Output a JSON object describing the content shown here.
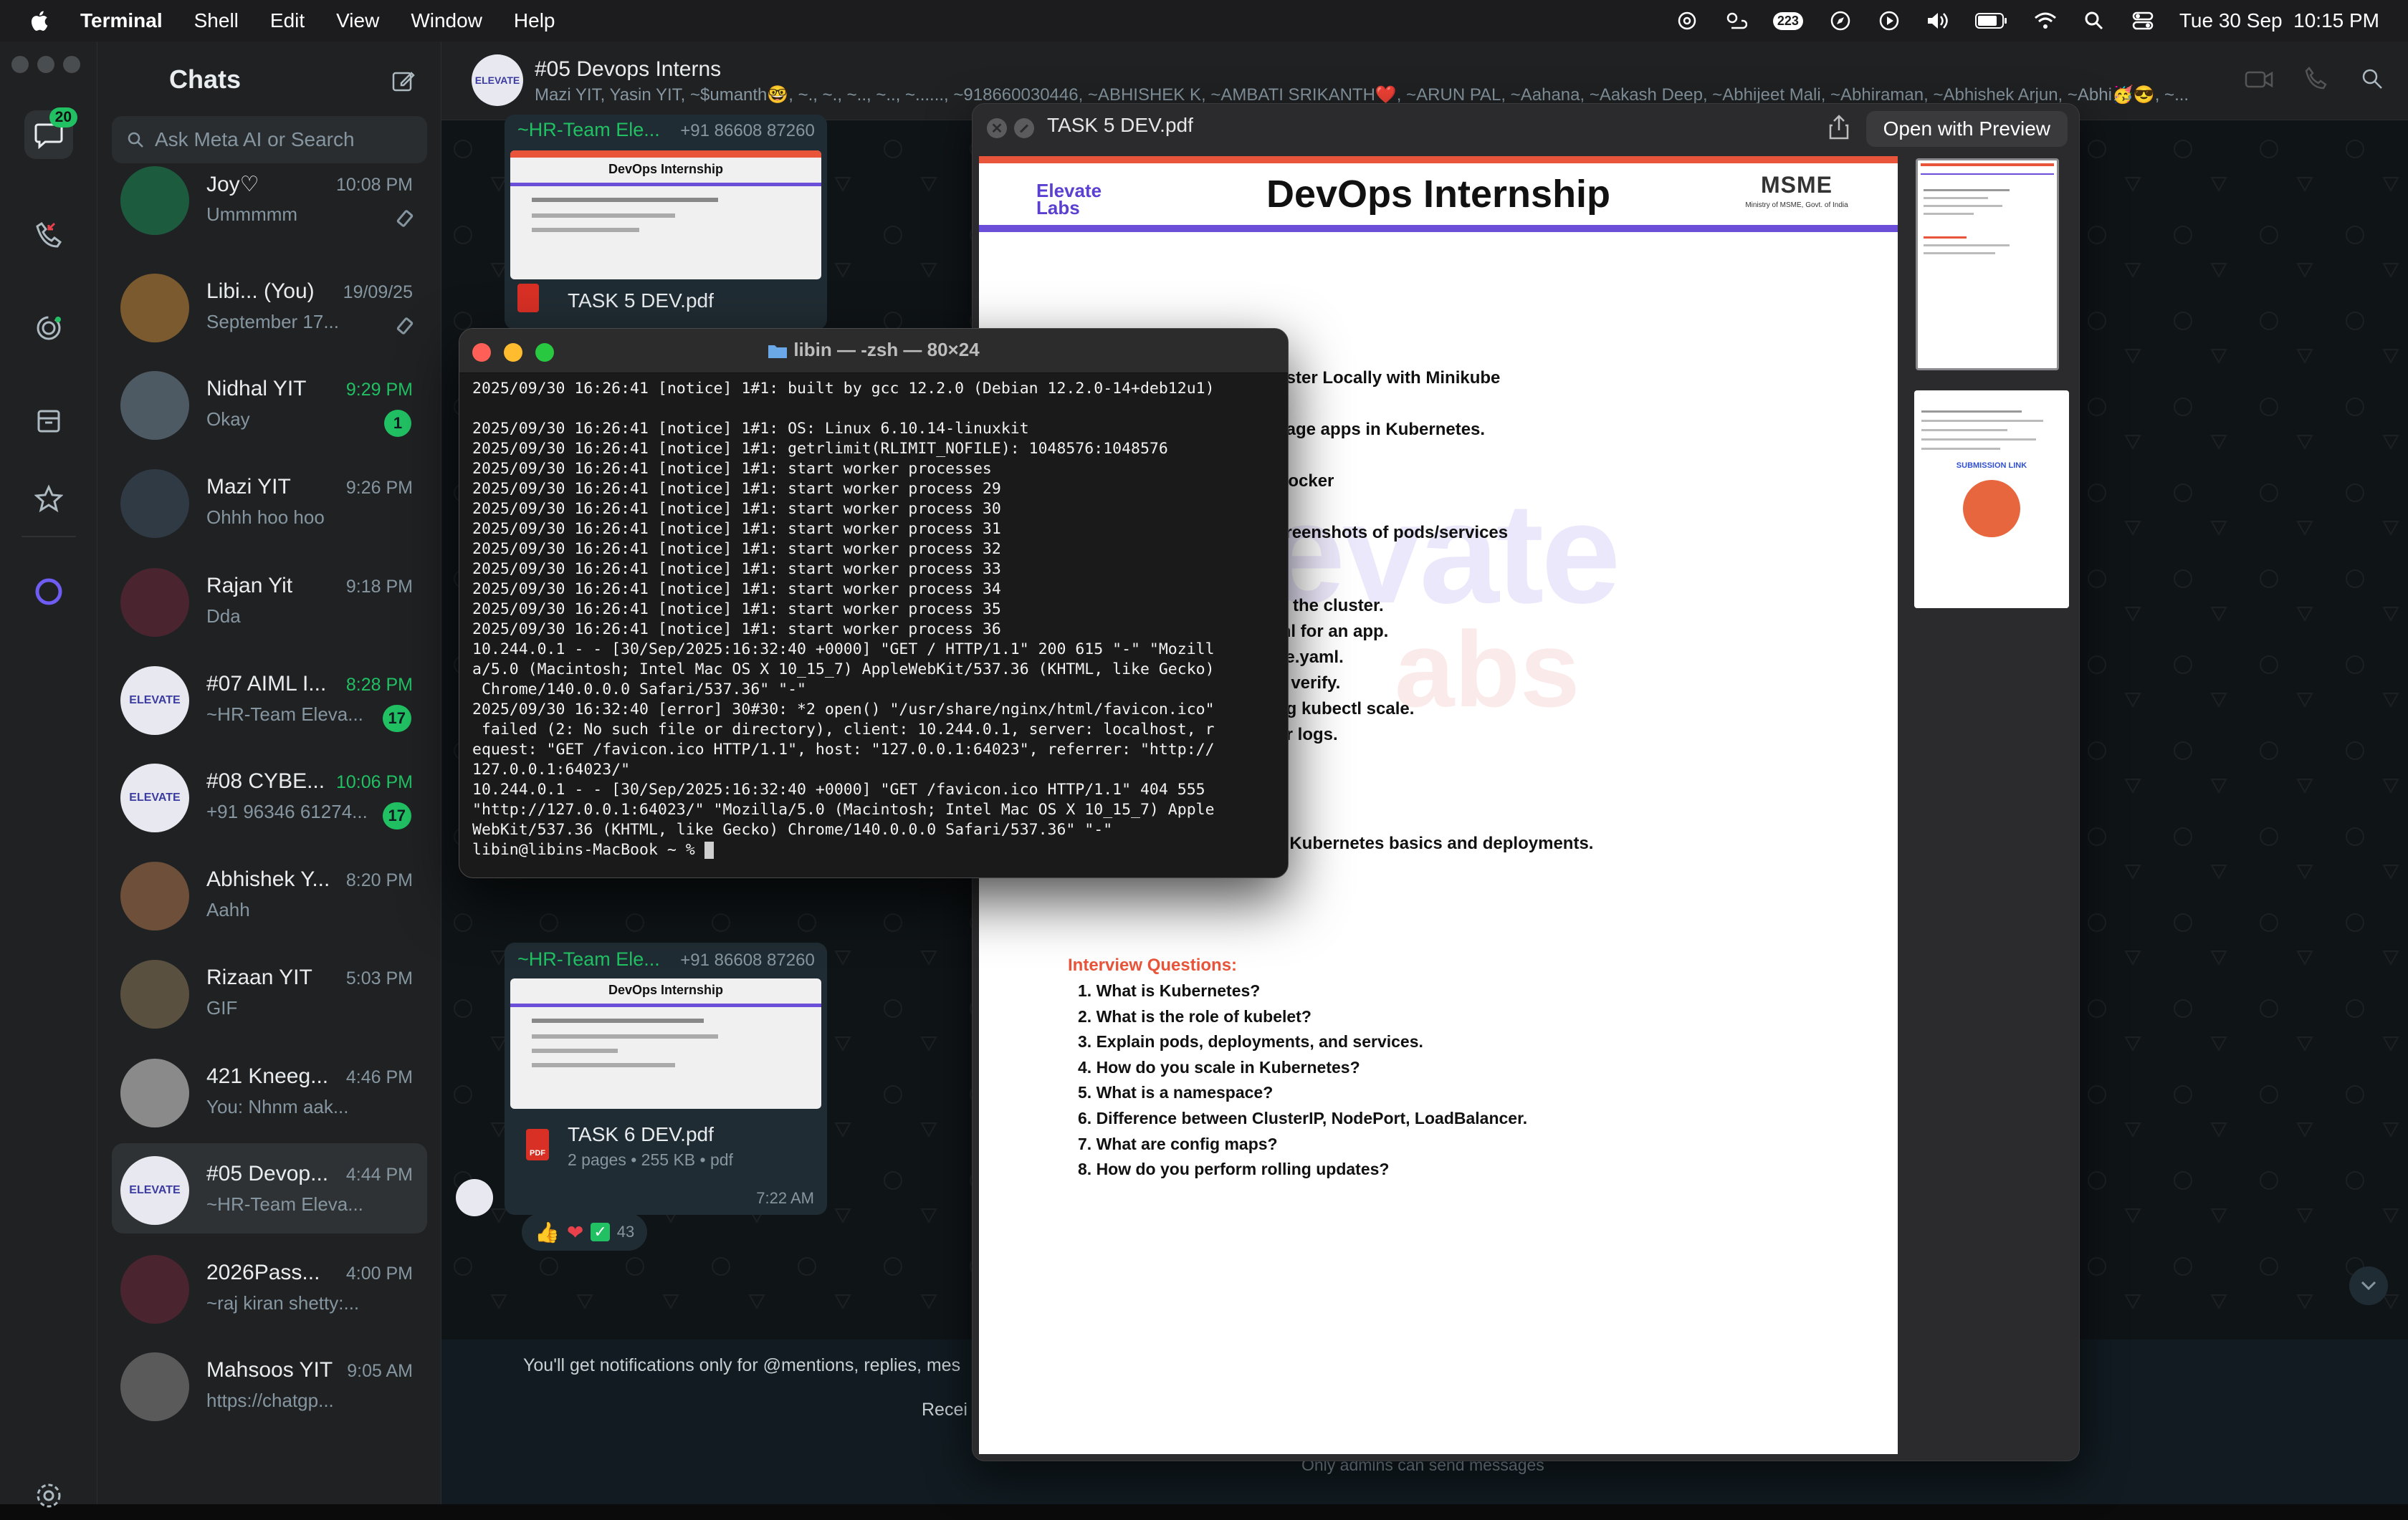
{
  "menubar": {
    "app": "Terminal",
    "items": [
      "Shell",
      "Edit",
      "View",
      "Window",
      "Help"
    ],
    "notif_count": "223",
    "datetime": "Tue 30 Sep  10:15 PM"
  },
  "rail": {
    "chats_badge": "20"
  },
  "chatlist": {
    "title": "Chats",
    "search_placeholder": "Ask Meta AI or Search",
    "chats": [
      {
        "name": "Joy♡",
        "msg": "Ummmmm",
        "time": "10:08 PM",
        "badge": "",
        "pinned": true,
        "avatar_color": "#1d5b3f"
      },
      {
        "name": "Libi...  (You)",
        "msg": "September 17...",
        "time": "19/09/25",
        "badge": "",
        "pinned": true,
        "avatar_color": "#7a5a2e"
      },
      {
        "name": "Nidhal YIT",
        "msg": "Okay",
        "time": "9:29 PM",
        "badge": "1",
        "avatar_color": "#4e5a63"
      },
      {
        "name": "Mazi YIT",
        "msg": "Ohhh hoo hoo",
        "time": "9:26 PM",
        "badge": "",
        "avatar_color": "#2f3a44"
      },
      {
        "name": "Rajan Yit",
        "msg": "Dda",
        "time": "9:18 PM",
        "badge": "",
        "avatar_color": "#4a2530"
      },
      {
        "name": "#07 AIML I...",
        "msg": "~HR-Team Eleva...",
        "time": "8:28 PM",
        "badge": "17",
        "avatar_color": "#e8e8f0"
      },
      {
        "name": "#08 CYBE...",
        "msg": "+91 96346 61274...",
        "time": "10:06 PM",
        "badge": "17",
        "avatar_color": "#e8e8f0"
      },
      {
        "name": "Abhishek Y...",
        "msg": "Aahh",
        "time": "8:20 PM",
        "badge": "",
        "avatar_color": "#6d4f3a"
      },
      {
        "name": "Rizaan YIT",
        "msg": "GIF",
        "time": "5:03 PM",
        "badge": "",
        "avatar_color": "#5a5040"
      },
      {
        "name": "421 Kneeg...",
        "msg": "You: Nhnm aak...",
        "time": "4:46 PM",
        "badge": "",
        "avatar_color": "#8a8a8a"
      },
      {
        "name": "#05 Devop...",
        "msg": "~HR-Team Eleva...",
        "time": "4:44 PM",
        "badge": "",
        "avatar_color": "#e8e8f0"
      },
      {
        "name": "2026Pass...",
        "msg": "~raj kiran shetty:...",
        "time": "4:00 PM",
        "badge": "",
        "avatar_color": "#4a2530"
      },
      {
        "name": "Mahsoos YIT",
        "msg": "https://chatgp...",
        "time": "9:05 AM",
        "badge": "",
        "avatar_color": "#5a5a5a"
      }
    ]
  },
  "conversation": {
    "title": "#05 Devops Interns",
    "subtitle": "Mazi YIT, Yasin YIT, ~$umanth🤓, ~., ~., ~.., ~.., ~......, ~918660030446, ~ABHISHEK K, ~AMBATI SRIKANTH❤️, ~ARUN PAL, ~Aahana, ~Aakash Deep, ~Abhijeet Mali, ~Abhiraman, ~Abhishek Arjun, ~Abhi🥳😎, ~...",
    "msg1": {
      "sender": "~HR-Team Ele...",
      "number": "+91 86608 87260",
      "doc_title": "DevOps Internship",
      "file": "TASK 5 DEV.pdf"
    },
    "msg2": {
      "sender": "~HR-Team Ele...",
      "number": "+91 86608 87260",
      "doc_title": "DevOps Internship",
      "file": "TASK 6 DEV.pdf",
      "meta": "2 pages • 255 KB • pdf",
      "time": "7:22 AM",
      "reaction_count": "43"
    },
    "notice": "You'll get notifications only for @mentions, replies, mes",
    "notice2": "Recei",
    "footer": "Only admins can send messages"
  },
  "quicklook": {
    "filename": "TASK 5 DEV.pdf",
    "open_button": "Open with Preview",
    "header": "DevOps Internship",
    "brand": "Elevate Labs",
    "ministry": "Ministry of MSME, Govt. of India",
    "task_lines": [
      "uster Locally with Minikube",
      "nage apps in Kubernetes.",
      "Docker",
      "creenshots of pods/services"
    ],
    "step_lines": [
      "rt the cluster.",
      "ml for an app.",
      "ce.yaml.",
      "o verify.",
      "ng kubectl scale.",
      "or logs."
    ],
    "outcome": "d Kubernetes basics and deployments.",
    "iq_title": "Interview Questions:",
    "questions": [
      "1. What is Kubernetes?",
      "2. What is the role of kubelet?",
      "3. Explain pods, deployments, and services.",
      "4. How do you scale in Kubernetes?",
      "5. What is a namespace?",
      "6. Difference between ClusterIP, NodePort, LoadBalancer.",
      "7. What are config maps?",
      "8. How do you perform rolling updates?"
    ],
    "thumb2_link": "SUBMISSION LINK"
  },
  "terminal": {
    "title": "libin — -zsh — 80×24",
    "lines": [
      "2025/09/30 16:26:41 [notice] 1#1: built by gcc 12.2.0 (Debian 12.2.0-14+deb12u1)",
      "",
      "2025/09/30 16:26:41 [notice] 1#1: OS: Linux 6.10.14-linuxkit",
      "2025/09/30 16:26:41 [notice] 1#1: getrlimit(RLIMIT_NOFILE): 1048576:1048576",
      "2025/09/30 16:26:41 [notice] 1#1: start worker processes",
      "2025/09/30 16:26:41 [notice] 1#1: start worker process 29",
      "2025/09/30 16:26:41 [notice] 1#1: start worker process 30",
      "2025/09/30 16:26:41 [notice] 1#1: start worker process 31",
      "2025/09/30 16:26:41 [notice] 1#1: start worker process 32",
      "2025/09/30 16:26:41 [notice] 1#1: start worker process 33",
      "2025/09/30 16:26:41 [notice] 1#1: start worker process 34",
      "2025/09/30 16:26:41 [notice] 1#1: start worker process 35",
      "2025/09/30 16:26:41 [notice] 1#1: start worker process 36",
      "10.244.0.1 - - [30/Sep/2025:16:32:40 +0000] \"GET / HTTP/1.1\" 200 615 \"-\" \"Mozill",
      "a/5.0 (Macintosh; Intel Mac OS X 10_15_7) AppleWebKit/537.36 (KHTML, like Gecko)",
      " Chrome/140.0.0.0 Safari/537.36\" \"-\"",
      "2025/09/30 16:32:40 [error] 30#30: *2 open() \"/usr/share/nginx/html/favicon.ico\"",
      " failed (2: No such file or directory), client: 10.244.0.1, server: localhost, r",
      "equest: \"GET /favicon.ico HTTP/1.1\", host: \"127.0.0.1:64023\", referrer: \"http://",
      "127.0.0.1:64023/\"",
      "10.244.0.1 - - [30/Sep/2025:16:32:40 +0000] \"GET /favicon.ico HTTP/1.1\" 404 555",
      "\"http://127.0.0.1:64023/\" \"Mozilla/5.0 (Macintosh; Intel Mac OS X 10_15_7) Apple",
      "WebKit/537.36 (KHTML, like Gecko) Chrome/140.0.0.0 Safari/537.36\" \"-\""
    ],
    "prompt": "libin@libins-MacBook ~ % "
  }
}
